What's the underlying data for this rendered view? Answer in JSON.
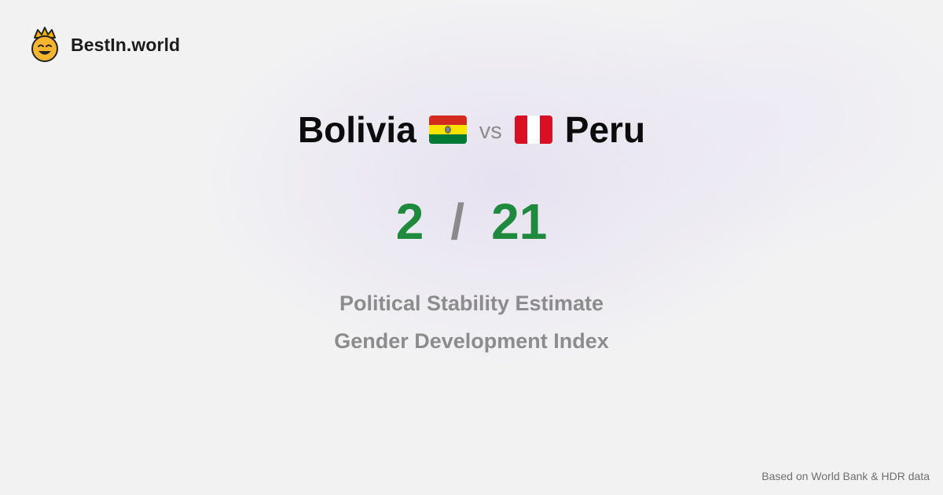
{
  "brand": {
    "name": "BestIn.world",
    "logo_icon": "crown-smiley-icon"
  },
  "comparison": {
    "left": {
      "name": "Bolivia",
      "flag": "bolivia-flag-icon",
      "flag_colors": [
        "#d52b1e",
        "#f9e300",
        "#007934"
      ]
    },
    "vs_label": "vs",
    "right": {
      "name": "Peru",
      "flag": "peru-flag-icon",
      "flag_colors": [
        "#d91023",
        "#ffffff",
        "#d91023"
      ]
    }
  },
  "score": {
    "left": "2",
    "separator": "/",
    "right": "21",
    "color": "#1f8a3e"
  },
  "metrics": [
    "Political Stability Estimate",
    "Gender Development Index"
  ],
  "source": "Based on World Bank & HDR data"
}
